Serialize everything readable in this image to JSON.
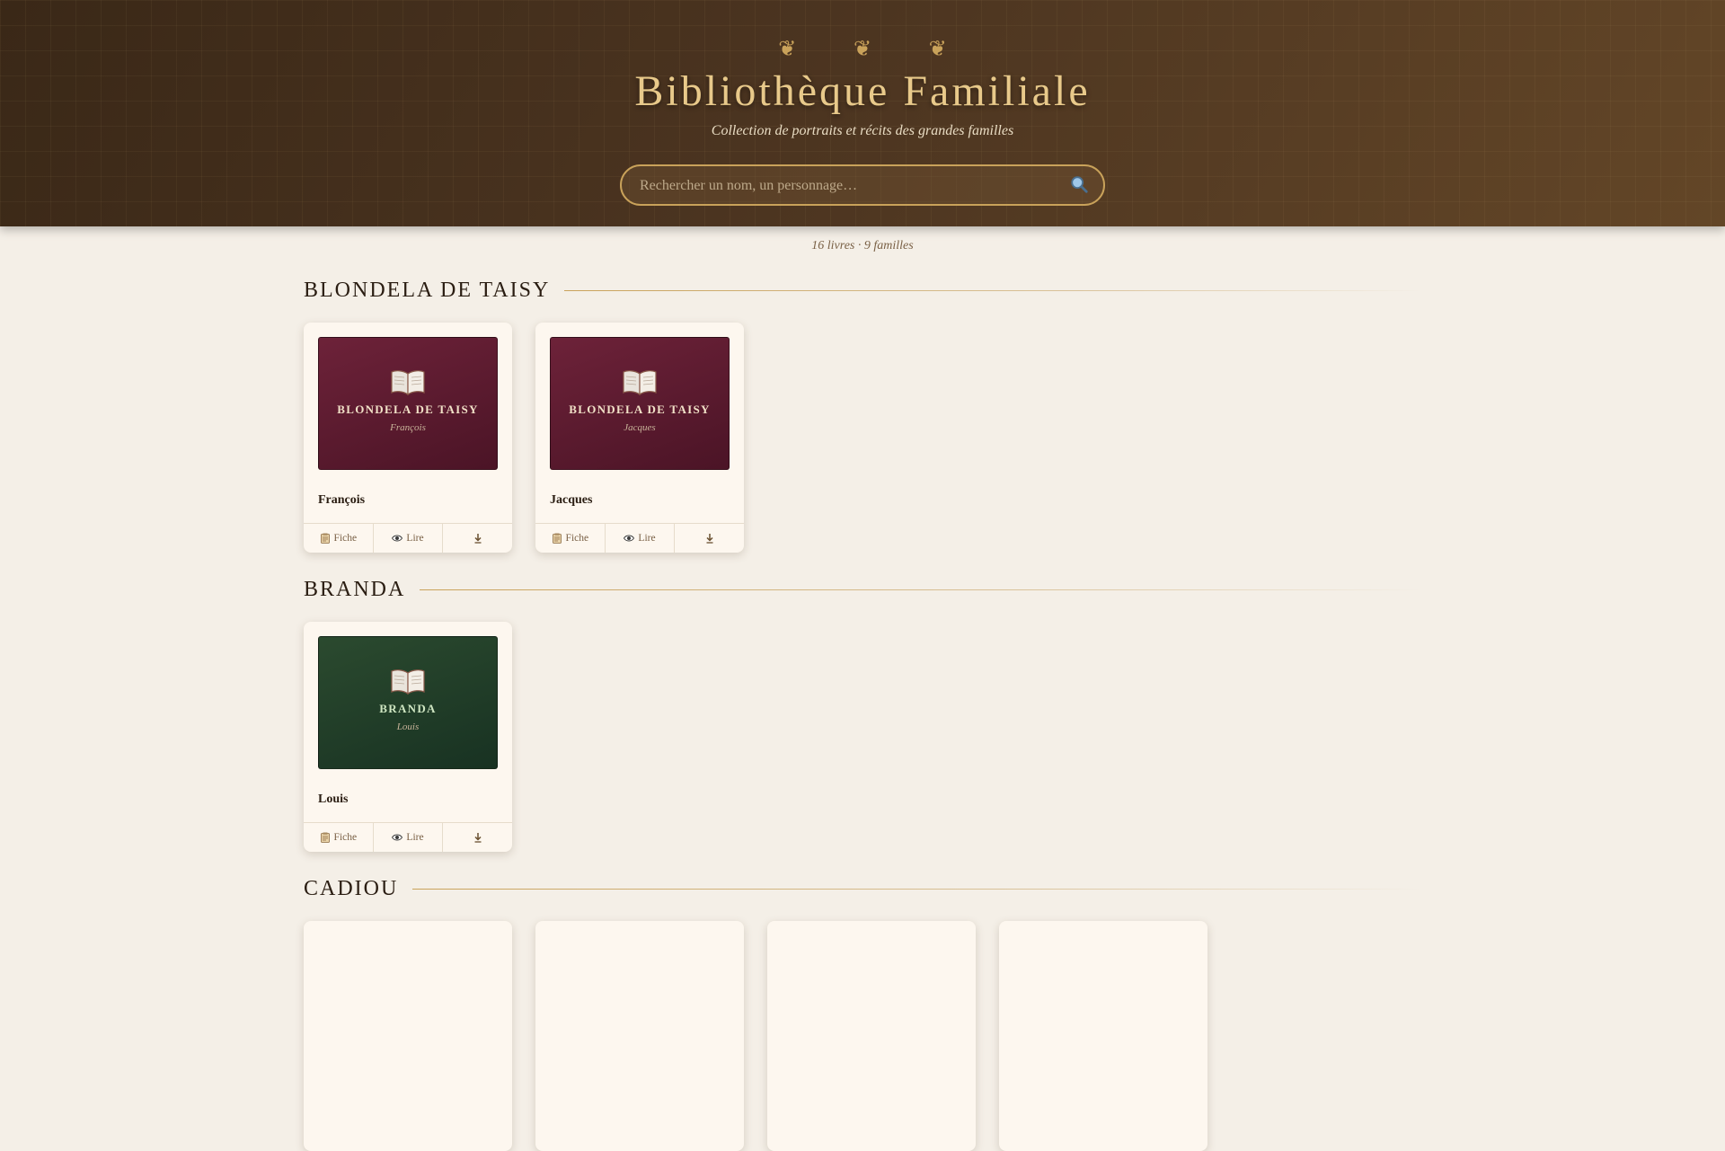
{
  "header": {
    "ornaments": "❦ ❦ ❦",
    "title": "Bibliothèque Familiale",
    "subtitle": "Collection de portraits et récits des grandes familles",
    "search_placeholder": "Rechercher un nom, un personnage…"
  },
  "stats": "16 livres · 9 familles",
  "colors": {
    "accent_gold": "#c9a25a",
    "cover_red": "#5c1a2f",
    "cover_green": "#22402a"
  },
  "actions": {
    "fiche": "Fiche",
    "lire": "Lire"
  },
  "families": [
    {
      "name": "BLONDELA DE TAISY",
      "books": [
        {
          "cover_title": "BLONDELA DE TAISY",
          "cover_sub": "François",
          "title": "François",
          "color": "red"
        },
        {
          "cover_title": "BLONDELA DE TAISY",
          "cover_sub": "Jacques",
          "title": "Jacques",
          "color": "red"
        }
      ]
    },
    {
      "name": "BRANDA",
      "books": [
        {
          "cover_title": "BRANDA",
          "cover_sub": "Louis",
          "title": "Louis",
          "color": "green"
        }
      ]
    },
    {
      "name": "CADIOU",
      "books": []
    }
  ]
}
